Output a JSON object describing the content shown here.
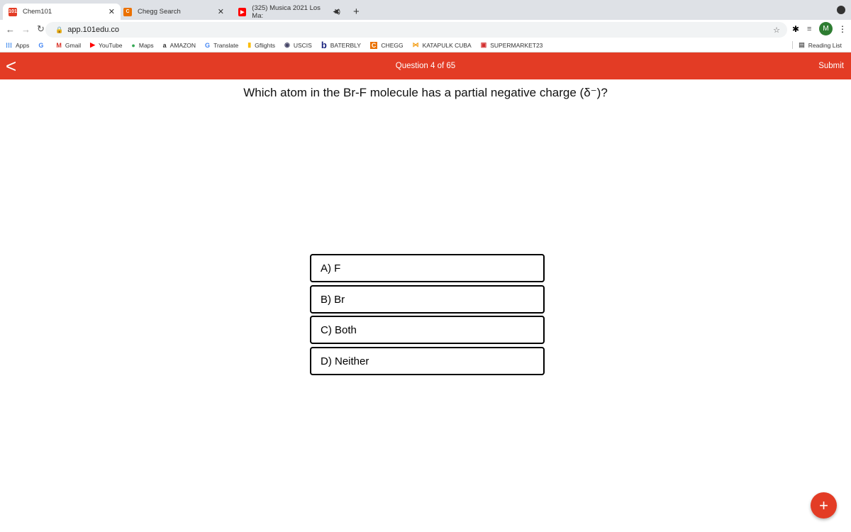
{
  "browser": {
    "tabs": [
      {
        "label": "Chem101",
        "favicon": "101"
      },
      {
        "label": "Chegg Search",
        "favicon": "C"
      },
      {
        "label": "(325) Musica 2021 Los Ma:",
        "favicon": "youtube"
      }
    ],
    "url": "app.101edu.co",
    "profile_initial": "M",
    "bookmarks": [
      "Apps",
      "Gmail",
      "YouTube",
      "Maps",
      "AMAZON",
      "Translate",
      "Gflights",
      "USCIS",
      "BATERBLY",
      "CHEGG",
      "KATAPULK CUBA",
      "SUPERMARKET23"
    ],
    "reading_list": "Reading List"
  },
  "header": {
    "progress": "Question 4 of 65",
    "submit": "Submit",
    "accent": "#e33c25"
  },
  "question": {
    "text": "Which atom in the Br-F molecule has a partial negative charge (δ⁻)?",
    "options": [
      "A) F",
      "B) Br",
      "C) Both",
      "D) Neither"
    ]
  },
  "fab": "+"
}
